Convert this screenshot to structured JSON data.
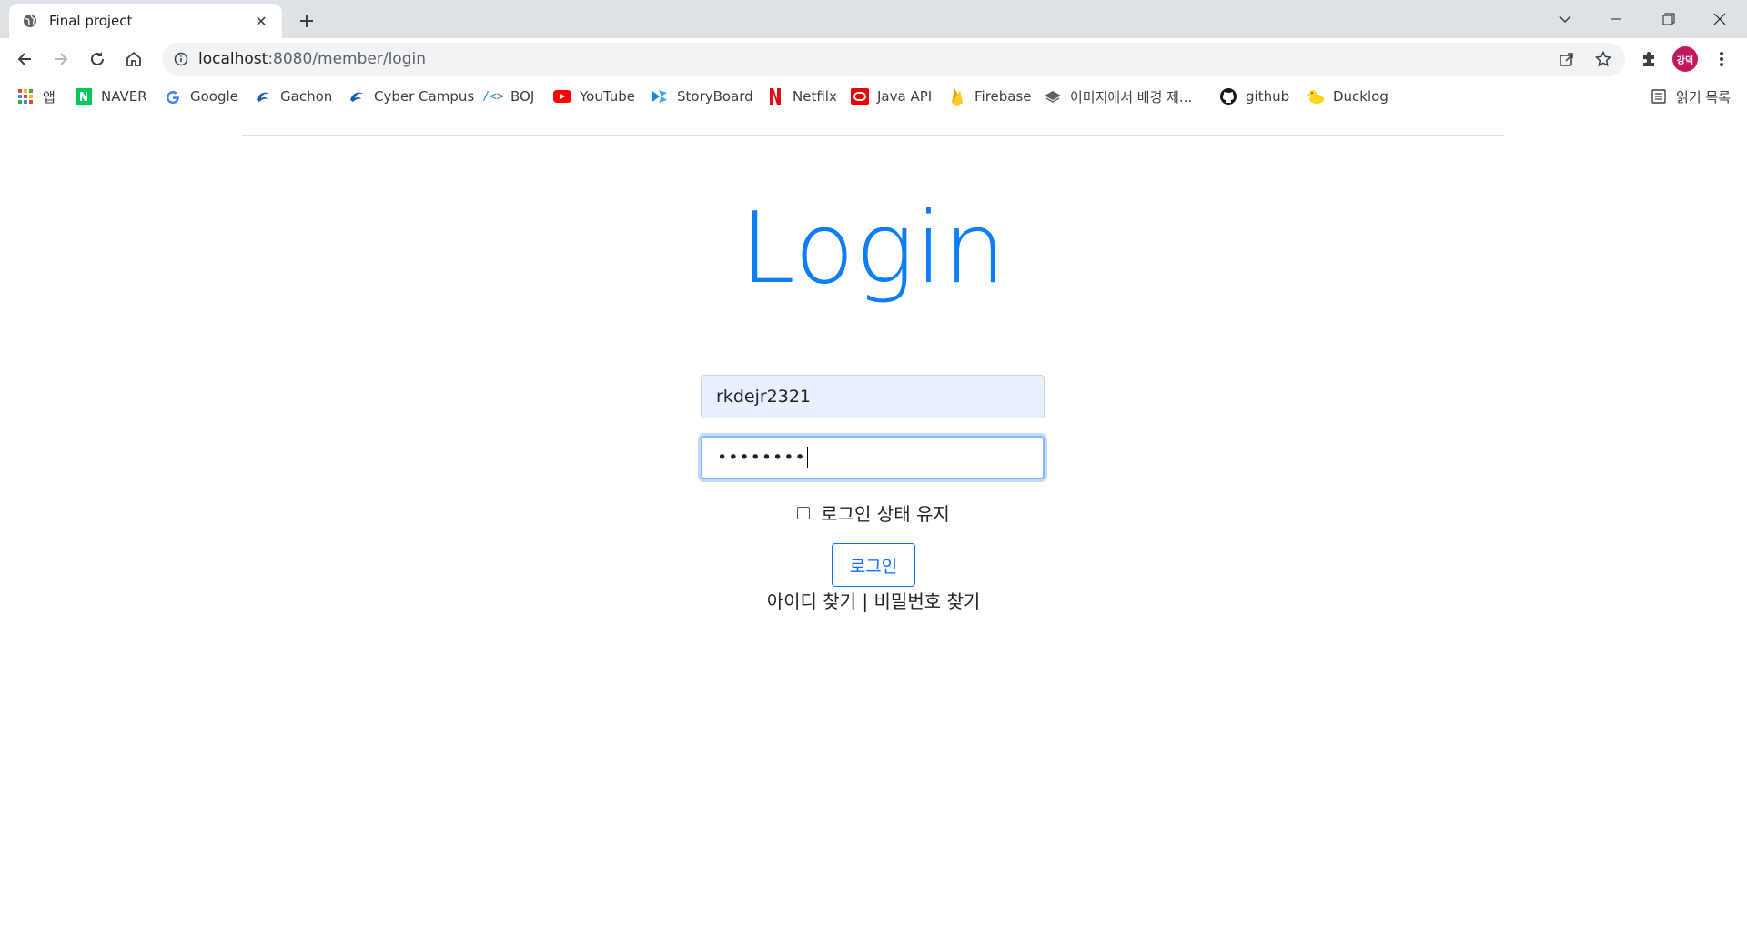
{
  "browser": {
    "tab": {
      "title": "Final project",
      "favicon": "globe-icon"
    },
    "new_tab_label": "+",
    "url": {
      "host": "localhost",
      "rest": ":8080/member/login"
    },
    "profile_initials": "강덕",
    "colors": {
      "tabstrip": "#dee1e6",
      "avatar": "#c2185b"
    }
  },
  "bookmarks": [
    {
      "label": "앱",
      "icon": "apps-grid-icon"
    },
    {
      "label": "NAVER",
      "icon": "naver-icon"
    },
    {
      "label": "Google",
      "icon": "google-icon"
    },
    {
      "label": "Gachon",
      "icon": "gachon-icon"
    },
    {
      "label": "Cyber Campus",
      "icon": "gachon-icon"
    },
    {
      "label": "BOJ",
      "icon": "code-icon"
    },
    {
      "label": "YouTube",
      "icon": "youtube-icon"
    },
    {
      "label": "StoryBoard",
      "icon": "storyboard-icon"
    },
    {
      "label": "Netfilx",
      "icon": "netflix-icon"
    },
    {
      "label": "Java API",
      "icon": "oracle-icon"
    },
    {
      "label": "Firebase",
      "icon": "firebase-icon"
    },
    {
      "label": "이미지에서 배경 제...",
      "icon": "layers-icon"
    },
    {
      "label": "github",
      "icon": "github-icon"
    },
    {
      "label": "Ducklog",
      "icon": "duck-icon"
    }
  ],
  "reading_list": "읽기 목록",
  "login": {
    "title": "Login",
    "username_value": "rkdejr2321",
    "password_value": "••••••••",
    "remember_label": "로그인 상태 유지",
    "submit_label": "로그인",
    "find_id": "아이디 찾기",
    "separator": "|",
    "find_password": "비밀번호 찾기",
    "colors": {
      "title": "#0d7ef5",
      "button": "#0d6efd",
      "autofill": "#e8f0fe"
    }
  }
}
